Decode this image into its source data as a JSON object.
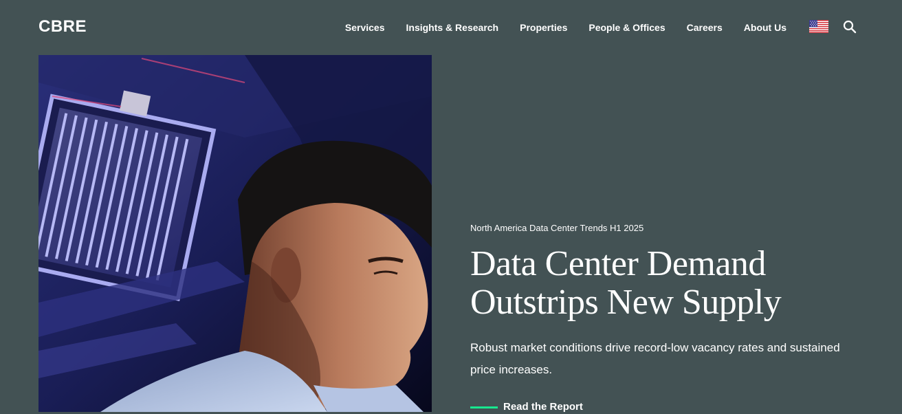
{
  "header": {
    "logo_text": "CBRE",
    "nav": [
      {
        "label": "Services"
      },
      {
        "label": "Insights & Research"
      },
      {
        "label": "Properties"
      },
      {
        "label": "People & Offices"
      },
      {
        "label": "Careers"
      },
      {
        "label": "About Us"
      }
    ],
    "locale_icon": "us-flag-icon",
    "search_icon": "search-icon"
  },
  "hero": {
    "image_subject": "",
    "eyebrow": "North America Data Center Trends H1 2025",
    "headline_line1": "Data Center Demand",
    "headline_line2": "Outstrips New Supply",
    "subcopy": "Robust market conditions drive record-low vacancy rates and sustained price increases.",
    "cta_label": "Read the Report"
  },
  "colors": {
    "background": "#435254",
    "text": "#ffffff",
    "accent": "#17e88f"
  }
}
